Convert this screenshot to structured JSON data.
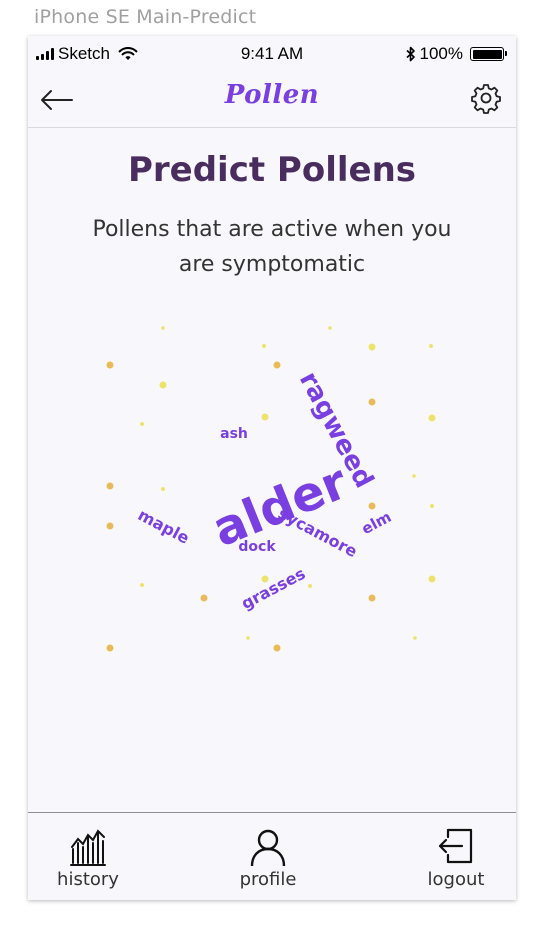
{
  "artboard_title": "iPhone SE Main-Predict",
  "status_bar": {
    "carrier": "Sketch",
    "time": "9:41 AM",
    "battery": "100%",
    "battery_level": 1.0
  },
  "nav": {
    "logo": "Pollen",
    "back_icon": "arrow-left-icon",
    "settings_icon": "gear-icon"
  },
  "page": {
    "title": "Predict Pollens",
    "subtitle": "Pollens that are active when you are symptomatic"
  },
  "word_cloud": {
    "words": [
      "alder",
      "ragweed",
      "ash",
      "maple",
      "dock",
      "sycamore",
      "elm",
      "grasses"
    ],
    "colors": {
      "word": "#7a3fe0",
      "dot_yellow": "#ece36a",
      "dot_orange": "#e8bb58"
    }
  },
  "tabs": [
    {
      "label": "history",
      "icon": "chart-icon"
    },
    {
      "label": "profile",
      "icon": "user-icon"
    },
    {
      "label": "logout",
      "icon": "logout-icon"
    }
  ],
  "colors": {
    "accent": "#7a3fe0",
    "title": "#4a2d5f",
    "background": "#f8f8fc"
  }
}
